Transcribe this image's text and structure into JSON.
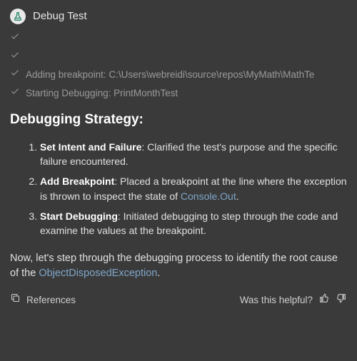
{
  "header": {
    "title": "Debug Test"
  },
  "progress": [
    {
      "text": ""
    },
    {
      "text": ""
    },
    {
      "text": "Adding breakpoint: C:\\Users\\webreidi\\source\\repos\\MyMath\\MathTe"
    },
    {
      "text": "Starting Debugging: PrintMonthTest"
    }
  ],
  "strategy": {
    "title": "Debugging Strategy:",
    "steps": [
      {
        "label": "Set Intent and Failure",
        "text_before": ": Clarified the test's purpose and the specific failure encountered."
      },
      {
        "label": "Add Breakpoint",
        "text_before": ": Placed a breakpoint at the line where the exception is thrown to inspect the state of ",
        "link": "Console.Out",
        "text_after": "."
      },
      {
        "label": "Start Debugging",
        "text_before": ": Initiated debugging to step through the code and examine the values at the breakpoint."
      }
    ]
  },
  "closing": {
    "before": "Now, let's step through the debugging process to identify the root cause of the ",
    "link": "ObjectDisposedException",
    "after": "."
  },
  "footer": {
    "references": "References",
    "helpful_prompt": "Was this helpful?"
  }
}
